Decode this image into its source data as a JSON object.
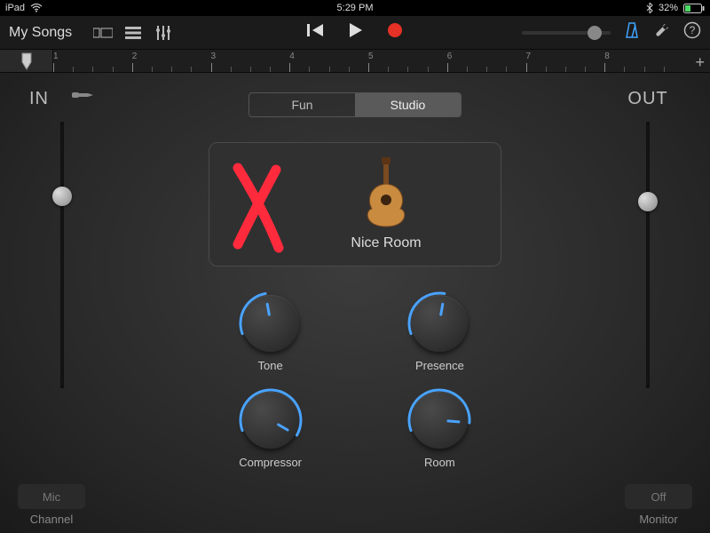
{
  "status_bar": {
    "device": "iPad",
    "time": "5:29 PM",
    "bluetooth_icon": "bluetooth",
    "battery_percent": "32%"
  },
  "toolbar": {
    "back_title": "My Songs"
  },
  "ruler": {
    "numbers": [
      "1",
      "2",
      "3",
      "4",
      "5",
      "6",
      "7",
      "8"
    ]
  },
  "segmented": {
    "fun": "Fun",
    "studio": "Studio",
    "active": "studio"
  },
  "io": {
    "in_label": "IN",
    "out_label": "OUT"
  },
  "preset": {
    "name": "Nice Room"
  },
  "knobs": [
    {
      "label": "Tone",
      "angle": -10,
      "arc_start": -110,
      "arc_end": -10
    },
    {
      "label": "Presence",
      "angle": 10,
      "arc_start": -110,
      "arc_end": 10
    },
    {
      "label": "Compressor",
      "angle": 120,
      "arc_start": -110,
      "arc_end": 120
    },
    {
      "label": "Room",
      "angle": 95,
      "arc_start": -110,
      "arc_end": 95
    }
  ],
  "sliders": {
    "in_pos_pct": 28,
    "out_pos_pct": 30
  },
  "bottom": {
    "mic_btn": "Mic",
    "channel_label": "Channel",
    "off_btn": "Off",
    "monitor_label": "Monitor"
  }
}
